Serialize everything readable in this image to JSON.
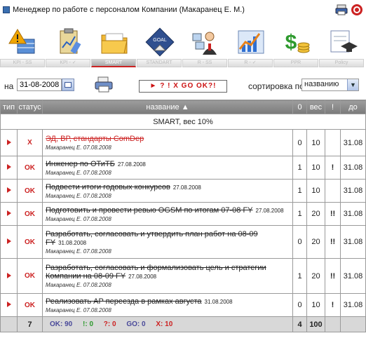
{
  "header": {
    "title": "Менеджер по работе с персоналом Компании  (Макаранец Е. М.)"
  },
  "tabs": [
    {
      "label": "KPI - SS",
      "active": false
    },
    {
      "label": "KPI - ✓",
      "active": false
    },
    {
      "label": "SMART",
      "active": true
    },
    {
      "label": "STANDART",
      "active": false
    },
    {
      "label": "R - SS",
      "active": false
    },
    {
      "label": "R - ✓",
      "active": false
    },
    {
      "label": "PPR",
      "active": false
    },
    {
      "label": "Policy",
      "active": false
    }
  ],
  "controls": {
    "date_label": "на",
    "date_value": "31-08-2008",
    "alert_label": "► ? ! X GO OK?!",
    "sort_label": "сортировка по",
    "sort_value": "названию"
  },
  "table": {
    "headers": {
      "type": "тип",
      "status": "статус",
      "name": "название ▲",
      "num": "0",
      "weight": "вес",
      "prio": "!",
      "due": "до"
    },
    "section": "SMART, вес 10%",
    "rows": [
      {
        "status": "X",
        "name": "ЭД, ВР, стандарты ComDep",
        "date": "",
        "author": "Макаранец Е. 07.08.2008",
        "num": "0",
        "weight": "10",
        "prio": "",
        "due": "31.08"
      },
      {
        "status": "OK",
        "name": "Инженер по ОТиТБ",
        "date": "27.08.2008",
        "author": "Макаранец Е. 07.08.2008",
        "num": "1",
        "weight": "10",
        "prio": "!",
        "due": "31.08"
      },
      {
        "status": "OK",
        "name": "Подвести итоги годовых конкурсов",
        "date": "27.08.2008",
        "author": "Макаранец Е. 07.08.2008",
        "num": "1",
        "weight": "10",
        "prio": "",
        "due": "31.08"
      },
      {
        "status": "OK",
        "name": "Подготовить и провести ревью OGSM по итогам 07-08 FY",
        "date": "27.08.2008",
        "author": "Макаранец Е. 07.08.2008",
        "num": "1",
        "weight": "20",
        "prio": "!!",
        "due": "31.08"
      },
      {
        "status": "OK",
        "name": "Разработать, согласовать и утвердить план работ на 08-09 FY",
        "date": "31.08.2008",
        "author": "Макаранец Е. 07.08.2008",
        "num": "0",
        "weight": "20",
        "prio": "!!",
        "due": "31.08"
      },
      {
        "status": "OK",
        "name": "Разработать, согласовать и формализовать цель и стратегии Компании на 08-09 FY",
        "date": "27.08.2008",
        "author": "Макаранец Е. 07.08.2008",
        "num": "1",
        "weight": "20",
        "prio": "!!",
        "due": "31.08"
      },
      {
        "status": "OK",
        "name": "Реализовать AP переезда в рамках августа",
        "date": "31.08.2008",
        "author": "Макаранец Е. 07.08.2008",
        "num": "0",
        "weight": "10",
        "prio": "!",
        "due": "31.08"
      }
    ],
    "footer": {
      "count": "7",
      "ok": "OK: 90",
      "excl": "!: 0",
      "q": "?: 0",
      "go": "GO: 0",
      "x": "X: 10",
      "num_total": "4",
      "weight_total": "100"
    }
  },
  "colors": {
    "accent_red": "#cc2222",
    "header_grey": "#8a8a8a"
  },
  "icons": [
    "warning-table-icon",
    "clipboard-chart-icon",
    "folder-icon",
    "goal-target-icon",
    "team-person-icon",
    "bar-chart-icon",
    "dollar-coins-icon",
    "certificate-cap-icon"
  ]
}
